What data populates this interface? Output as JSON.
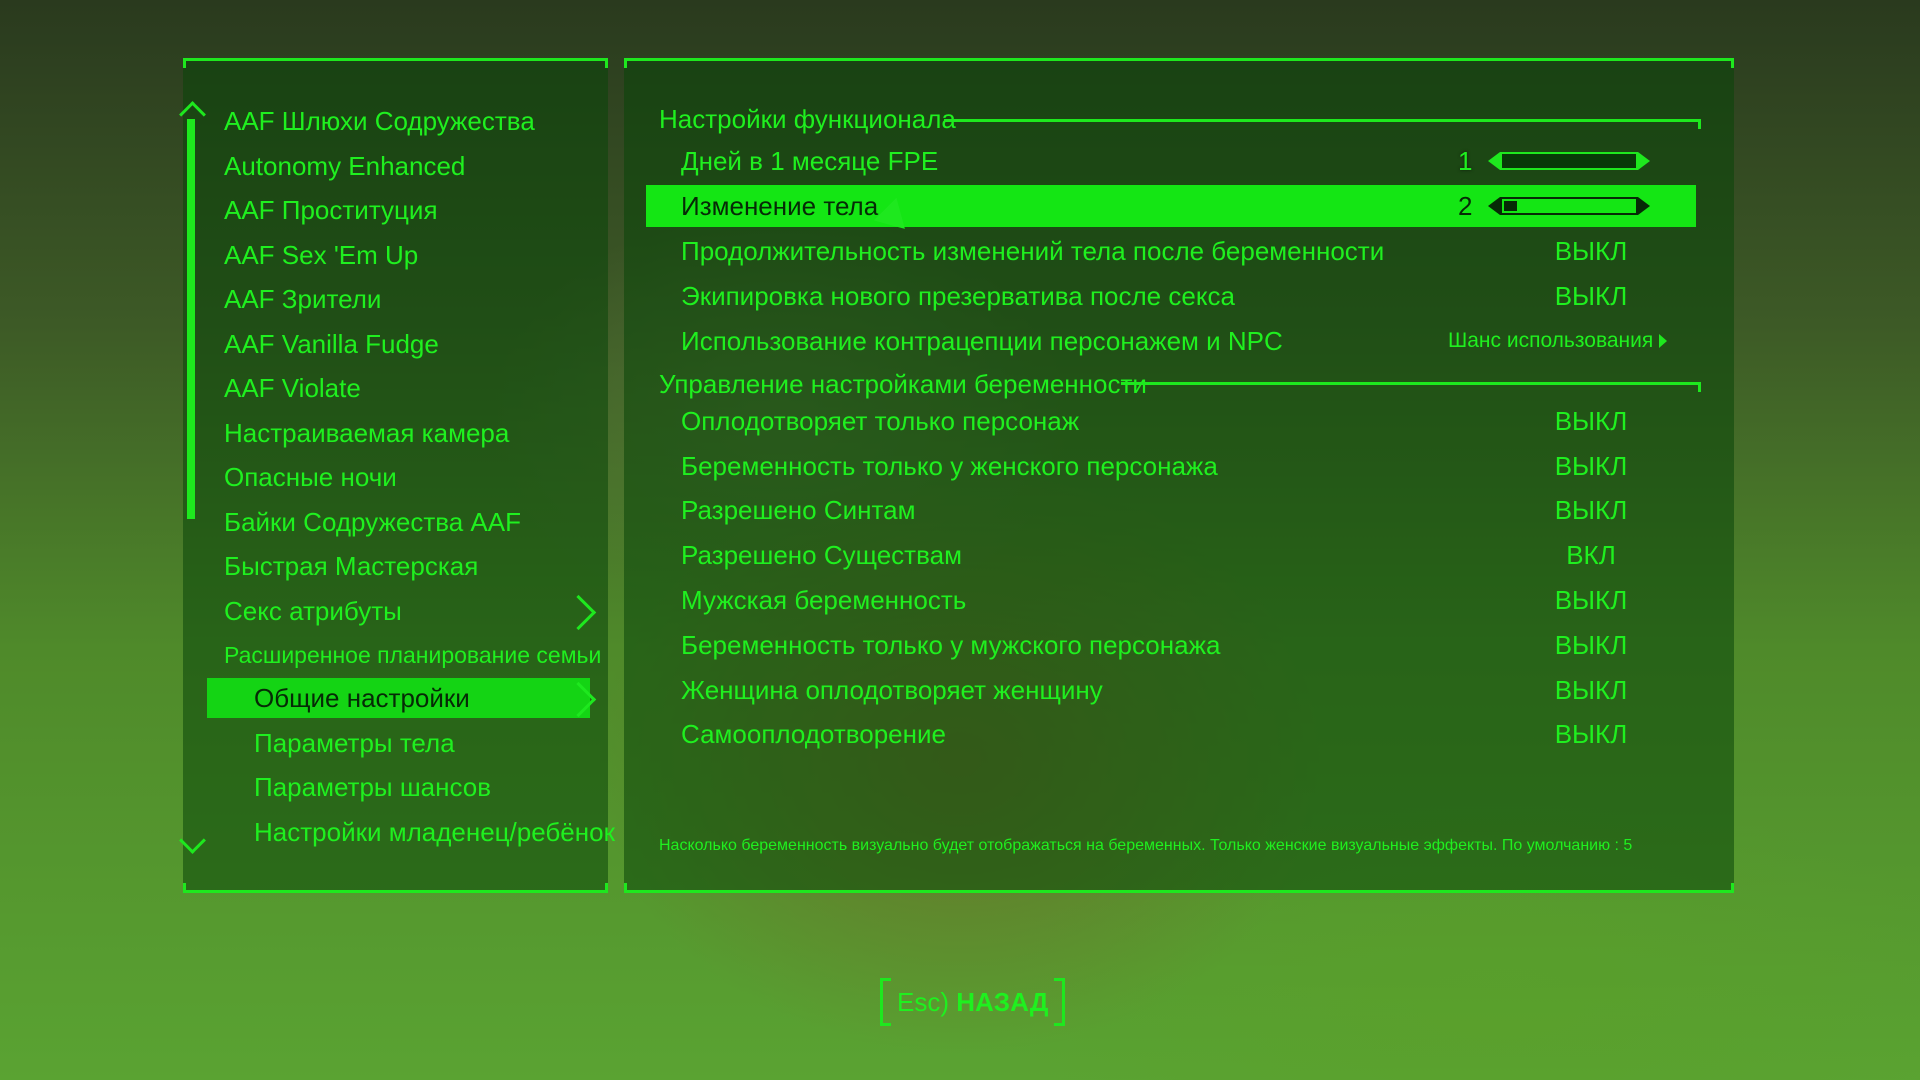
{
  "mod_list": {
    "items": [
      {
        "label": "AAF Шлюхи Содружества"
      },
      {
        "label": "Autonomy Enhanced"
      },
      {
        "label": "AAF Проституция"
      },
      {
        "label": "AAF Sex 'Em Up"
      },
      {
        "label": "AAF Зрители"
      },
      {
        "label": "AAF Vanilla Fudge"
      },
      {
        "label": "AAF Violate"
      },
      {
        "label": "Настраиваемая камера"
      },
      {
        "label": "Опасные ночи"
      },
      {
        "label": "Байки Содружества AAF"
      },
      {
        "label": "Быстрая Мастерская"
      },
      {
        "label": "Секс атрибуты"
      },
      {
        "label": "Расширенное планирование семьи"
      }
    ],
    "subitems": [
      {
        "label": "Общие настройки"
      },
      {
        "label": "Параметры тела"
      },
      {
        "label": "Параметры шансов"
      },
      {
        "label": "Настройки младенец/ребёнок"
      }
    ]
  },
  "settings": {
    "section1_title": "Настройки функционала",
    "section2_title": "Управление настройками беременности",
    "rows1": [
      {
        "label": "Дней в 1 месяце FPE",
        "value": "1",
        "type": "slider",
        "fill": 0.0
      },
      {
        "label": "Изменение тела",
        "value": "2",
        "type": "slider",
        "fill": 0.1
      },
      {
        "label": "Продолжительность изменений тела после беременности",
        "value": "ВЫКЛ"
      },
      {
        "label": "Экипировка нового презерватива после секса",
        "value": "ВЫКЛ"
      },
      {
        "label": "Использование контрацепции персонажем и NPC",
        "value": "Шанс использования"
      }
    ],
    "rows2": [
      {
        "label": "Оплодотворяет только персонаж",
        "value": "ВЫКЛ"
      },
      {
        "label": "Беременность только у женского персонажа",
        "value": "ВЫКЛ"
      },
      {
        "label": "Разрешено Синтам",
        "value": "ВЫКЛ"
      },
      {
        "label": "Разрешено Существам",
        "value": "ВКЛ"
      },
      {
        "label": "Мужская беременность",
        "value": "ВЫКЛ"
      },
      {
        "label": "Беременность только у мужского персонажа",
        "value": "ВЫКЛ"
      },
      {
        "label": "Женщина оплодотворяет женщину",
        "value": "ВЫКЛ"
      },
      {
        "label": "Самооплодотворение",
        "value": "ВЫКЛ"
      }
    ]
  },
  "description": "Насколько беременность визуально будет отображаться на беременных. Только женские визуальные эффекты. По умолчанию : 5",
  "footer": {
    "back_key": "Esc)",
    "back_label": "НАЗАД"
  },
  "colors": {
    "accent": "#1ee81e",
    "selected_bg": "#14e614",
    "selected_text": "#062a06"
  }
}
